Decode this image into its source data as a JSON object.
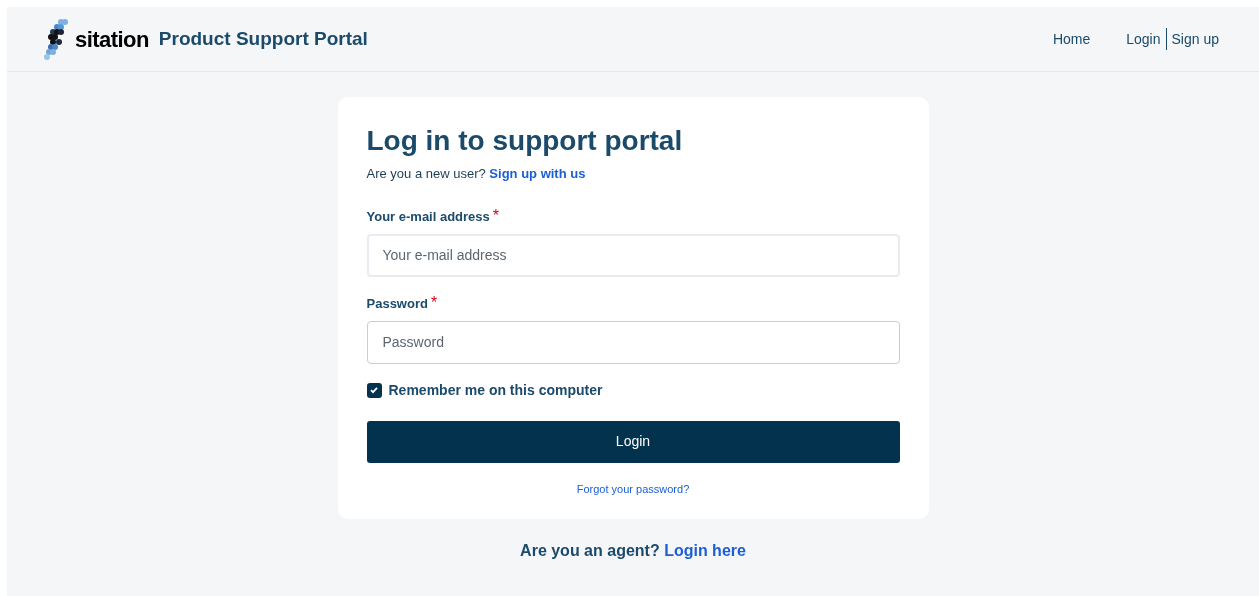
{
  "header": {
    "logo_text": "sitation",
    "title": "Product Support Portal",
    "nav": [
      {
        "label": "Home"
      },
      {
        "label": "Login"
      },
      {
        "label": "Sign up"
      }
    ]
  },
  "form": {
    "title": "Log in to support portal",
    "intro": "Are you a new user?",
    "signup_link": "Sign up with us",
    "fields": [
      {
        "label": "Your e-mail address",
        "required_mark": "*",
        "placeholder": "Your e-mail address",
        "kind": "email"
      },
      {
        "label": "Password",
        "required_mark": "*",
        "placeholder": "Password",
        "kind": "password"
      }
    ],
    "remember": {
      "label": "Remember me on this computer",
      "checked": true
    },
    "submit": "Login",
    "forgot": "Forgot your password?"
  },
  "agent": {
    "text": "Are you an agent?",
    "link": "Login here"
  }
}
